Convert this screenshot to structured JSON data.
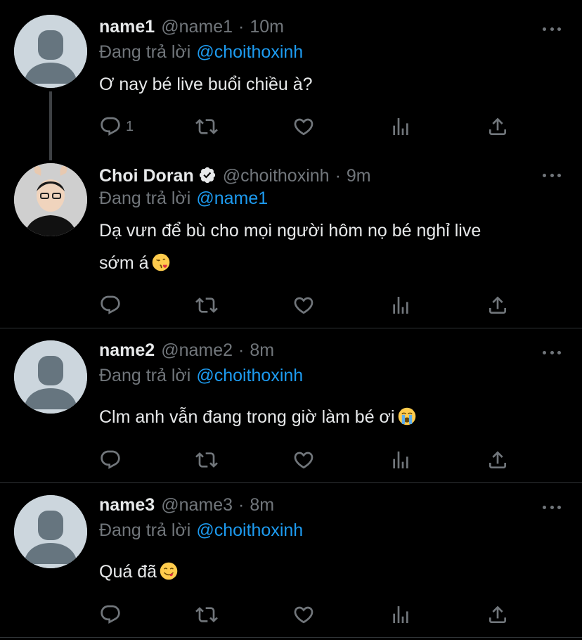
{
  "tweets": [
    {
      "name": "name1",
      "handle": "@name1",
      "time": "10m",
      "replying_prefix": "Đang trả lời",
      "replying_to": "@choithoxinh",
      "text": "Ơ nay bé live buổi chiều à?",
      "reply_count": "1"
    },
    {
      "name": "Choi Doran",
      "handle": "@choithoxinh",
      "time": "9m",
      "replying_prefix": "Đang trả lời",
      "replying_to": "@name1",
      "text_line1": "Dạ vưn để bù cho mọi người hôm nọ bé nghỉ live",
      "text_line2": "sớm á",
      "emoji": "kissing-face-emoji"
    },
    {
      "name": "name2",
      "handle": "@name2",
      "time": "8m",
      "replying_prefix": "Đang trả lời",
      "replying_to": "@choithoxinh",
      "text": "Clm anh vẫn đang trong giờ làm bé ơi",
      "emoji": "loudly-crying-face-emoji"
    },
    {
      "name": "name3",
      "handle": "@name3",
      "time": "8m",
      "replying_prefix": "Đang trả lời",
      "replying_to": "@choithoxinh",
      "text": "Quá đã",
      "emoji": "face-savoring-food-emoji"
    }
  ],
  "separator": "·",
  "colors": {
    "background": "#000000",
    "text": "#e7e9ea",
    "muted": "#71767b",
    "link": "#1d9bf0"
  }
}
